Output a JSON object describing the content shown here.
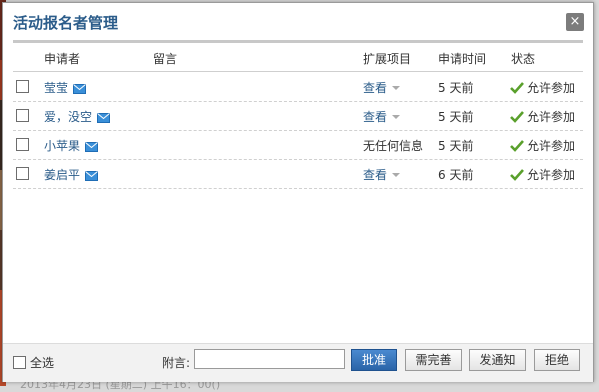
{
  "dialog": {
    "title": "活动报名者管理",
    "close_glyph": "×"
  },
  "columns": {
    "applicant": "申请者",
    "message": "留言",
    "extension": "扩展项目",
    "time": "申请时间",
    "status": "状态"
  },
  "rows": [
    {
      "name": "莹莹",
      "extension": "查看",
      "extension_is_link": true,
      "time": "5 天前",
      "status": "允许参加"
    },
    {
      "name": "爱，没空",
      "extension": "查看",
      "extension_is_link": true,
      "time": "5 天前",
      "status": "允许参加"
    },
    {
      "name": "小苹果",
      "extension": "无任何信息",
      "extension_is_link": false,
      "time": "5 天前",
      "status": "允许参加"
    },
    {
      "name": "姜启平",
      "extension": "查看",
      "extension_is_link": true,
      "time": "6 天前",
      "status": "允许参加"
    }
  ],
  "footer": {
    "select_all": "全选",
    "note_label": "附言:",
    "note_value": "",
    "buttons": {
      "approve": "批准",
      "need_complete": "需完善",
      "notify": "发通知",
      "reject": "拒绝"
    }
  },
  "background": {
    "bottom_text": "2013年4月23日 (星期二) 上午16：00()"
  },
  "colors": {
    "title": "#2b5c8a",
    "link": "#2b5c8a",
    "check": "#5aa02c",
    "mail": "#3a8fd8",
    "primary_button": "#2a64a8"
  }
}
